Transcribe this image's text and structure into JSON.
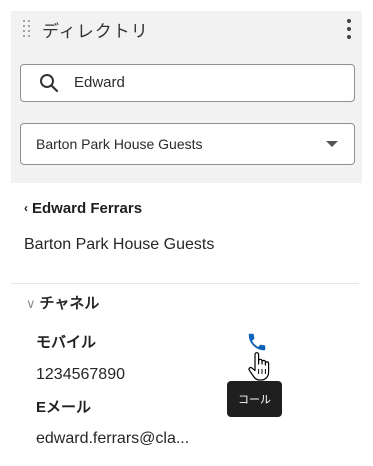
{
  "header": {
    "title": "ディレクトリ"
  },
  "search": {
    "value": "Edward"
  },
  "directory_select": {
    "selected": "Barton Park House Guests"
  },
  "contact": {
    "back_label": "Edward Ferrars",
    "group": "Barton Park House Guests"
  },
  "channel": {
    "label": "チャネル",
    "mobile_label": "モバイル",
    "mobile_value": "1234567890",
    "email_label": "Eメール",
    "email_value": "edward.ferrars@cla..."
  },
  "tooltip": {
    "text": "コール"
  },
  "colors": {
    "accent": "#0a63b8",
    "header_bg": "#f2f2f2"
  }
}
